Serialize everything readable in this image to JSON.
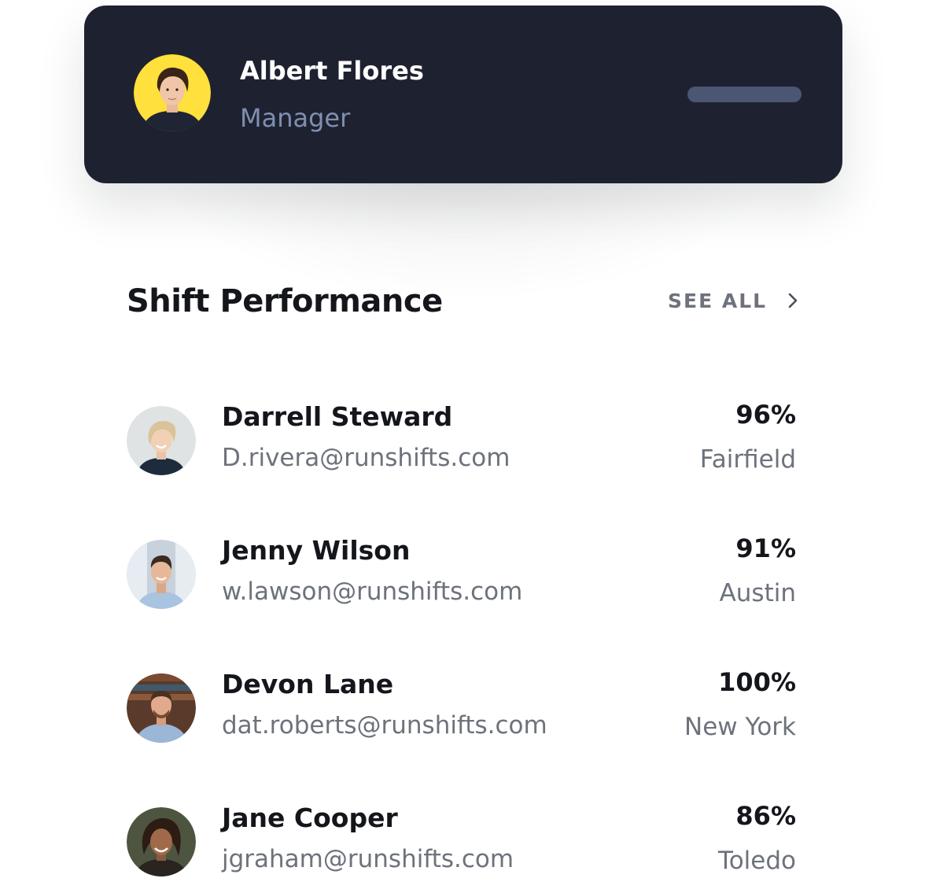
{
  "profile": {
    "name": "Albert Flores",
    "role": "Manager",
    "avatar_bg": "#ffe03c"
  },
  "section": {
    "title": "Shift Performance",
    "see_all_label": "SEE ALL",
    "see_all_icon": "chevron-right-icon"
  },
  "members": [
    {
      "name": "Darrell Steward",
      "email": "D.rivera@runshifts.com",
      "score": "96%",
      "location": "Fairfield"
    },
    {
      "name": "Jenny Wilson",
      "email": "w.lawson@runshifts.com",
      "score": "91%",
      "location": "Austin"
    },
    {
      "name": "Devon Lane",
      "email": "dat.roberts@runshifts.com",
      "score": "100%",
      "location": "New York"
    },
    {
      "name": "Jane Cooper",
      "email": "jgraham@runshifts.com",
      "score": "86%",
      "location": "Toledo"
    }
  ],
  "colors": {
    "card_bg": "#1e2230",
    "role_text": "#7f8fb0",
    "bar": "#4a5673",
    "title_text": "#14161c",
    "muted_text": "#6d727c"
  }
}
